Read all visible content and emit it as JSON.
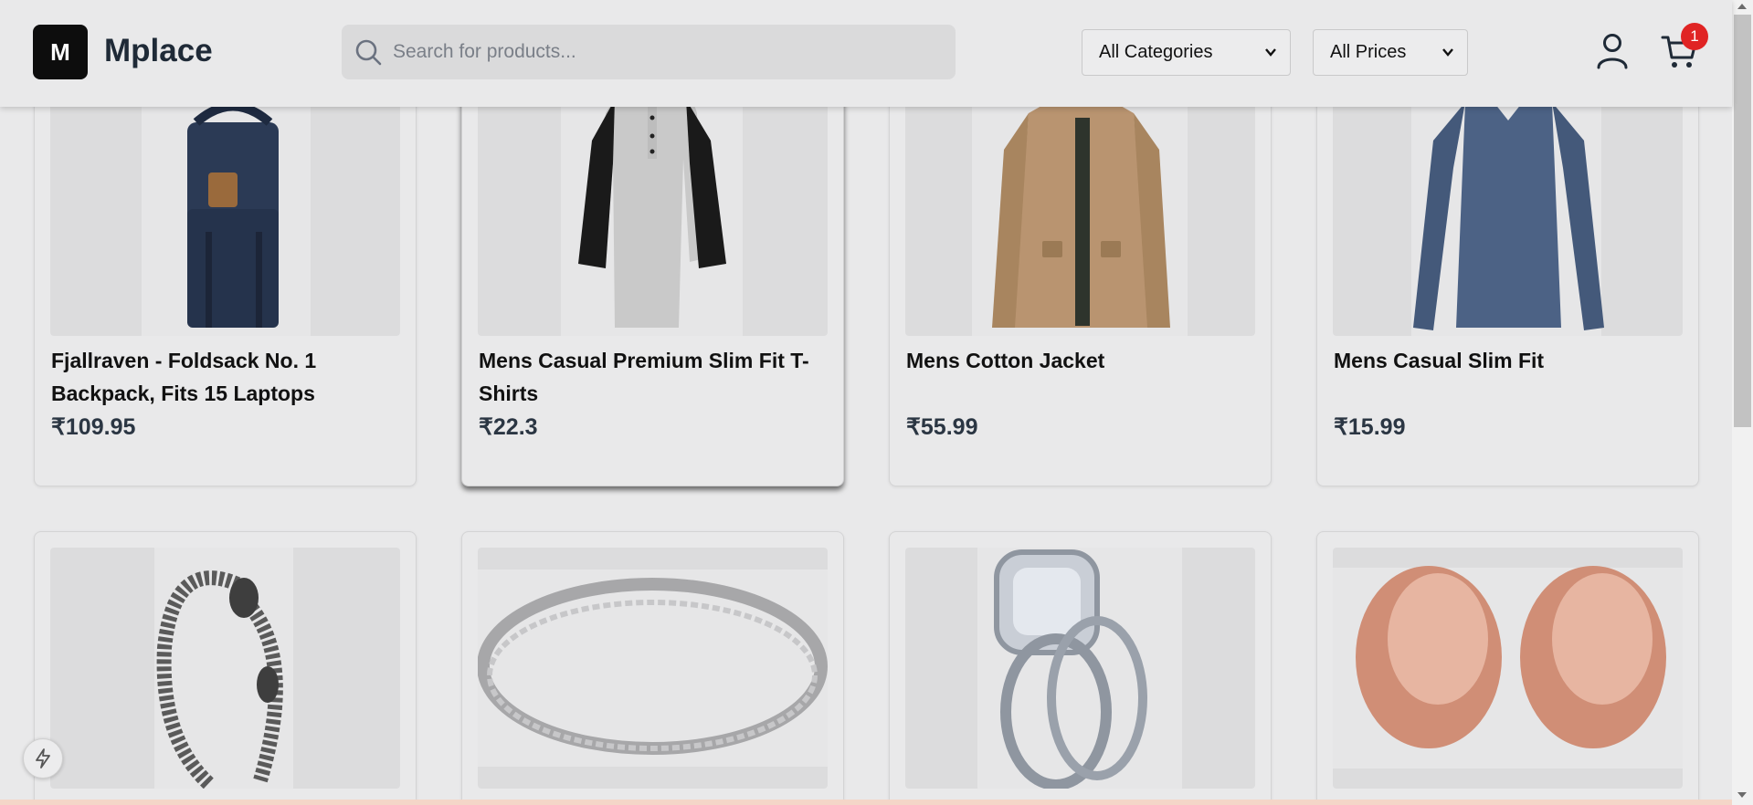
{
  "header": {
    "logo_letter": "M",
    "brand": "Mplace",
    "search_placeholder": "Search for products...",
    "category_select": "All Categories",
    "price_select": "All Prices",
    "cart_count": "1"
  },
  "products": [
    {
      "title": "Fjallraven - Foldsack No. 1 Backpack, Fits 15 Laptops",
      "price": "₹109.95",
      "image": "navy-backpack"
    },
    {
      "title": "Mens Casual Premium Slim Fit T-Shirts",
      "price": "₹22.3",
      "image": "raglan-henley-shirt"
    },
    {
      "title": "Mens Cotton Jacket",
      "price": "₹55.99",
      "image": "khaki-jacket"
    },
    {
      "title": "Mens Casual Slim Fit",
      "price": "₹15.99",
      "image": "blue-long-sleeve-shirt"
    },
    {
      "title": "",
      "price": "",
      "image": "dragon-chain-bracelet"
    },
    {
      "title": "",
      "price": "",
      "image": "silver-diamond-band"
    },
    {
      "title": "",
      "price": "",
      "image": "princess-ring-set"
    },
    {
      "title": "",
      "price": "",
      "image": "rose-gold-tunnel-plugs"
    }
  ],
  "colors": {
    "accent": "#0d0d0d",
    "badge": "#e02424",
    "price": "#2b3643"
  }
}
